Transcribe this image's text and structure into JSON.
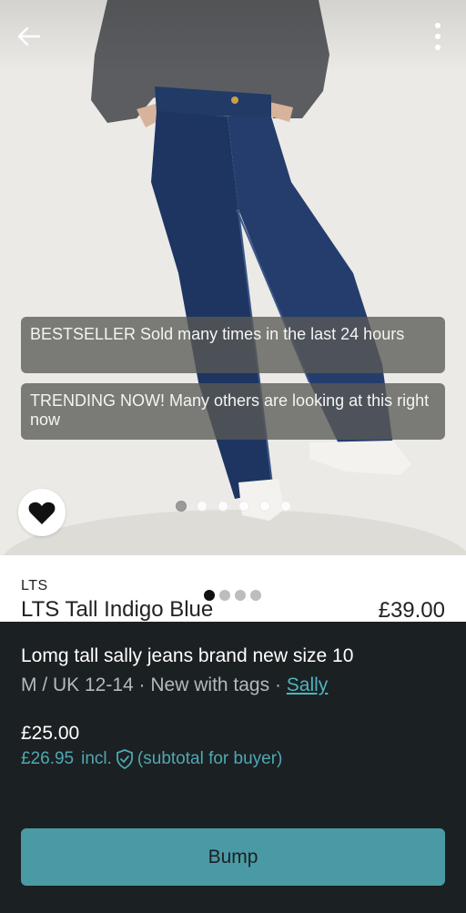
{
  "header": {
    "back_icon": "arrow-left-icon",
    "menu_icon": "more-vertical-icon"
  },
  "banners": [
    {
      "text": "BESTSELLER Sold many times in the last 24 hours"
    },
    {
      "text": "TRENDING NOW! Many others are looking at this right now"
    }
  ],
  "gallery": {
    "dot_count": 6,
    "active_index": 0
  },
  "favourite": {
    "icon": "heart-icon",
    "state": "filled"
  },
  "photo_listing": {
    "brand": "LTS",
    "name": "LTS Tall Indigo Blue",
    "price": "£39.00",
    "dot_count": 4,
    "active_index": 0
  },
  "listing": {
    "title": "Lomg tall sally jeans brand new size 10",
    "size": "M / UK 12-14",
    "separator": " · ",
    "condition": "New with tags",
    "brand_link": "Sally",
    "price": "£25.00",
    "buyer_price": "£26.95",
    "buyer_incl": "incl.",
    "buyer_note": "(subtotal for buyer)",
    "shield_icon": "shield-check-icon"
  },
  "actions": {
    "bump_label": "Bump"
  },
  "colors": {
    "accent": "#4fa8b3",
    "button": "#4a9aa5",
    "panel": "#1b2022"
  }
}
